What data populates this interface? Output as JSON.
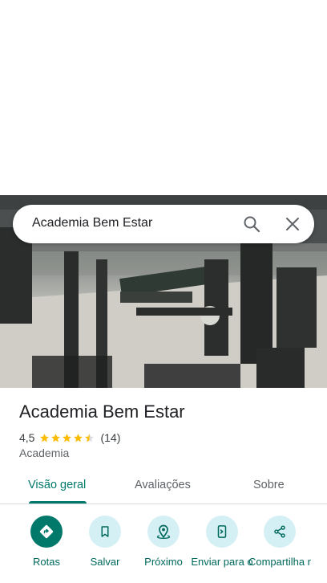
{
  "search": {
    "query": "Academia Bem Estar"
  },
  "place": {
    "title": "Academia Bem Estar",
    "rating": "4,5",
    "rating_stars": 4.5,
    "review_count": "(14)",
    "category": "Academia"
  },
  "tabs": [
    {
      "label": "Visão geral",
      "active": true
    },
    {
      "label": "Avaliações",
      "active": false
    },
    {
      "label": "Sobre",
      "active": false
    }
  ],
  "actions": [
    {
      "label": "Rotas",
      "icon": "directions-icon"
    },
    {
      "label": "Salvar",
      "icon": "bookmark-icon"
    },
    {
      "label": "Próximo",
      "icon": "nearby-icon"
    },
    {
      "label": "Enviar para o",
      "icon": "send-to-phone-icon"
    },
    {
      "label": "Compartilha r",
      "icon": "share-icon"
    }
  ],
  "colors": {
    "accent": "#00796b",
    "action_bg": "#d4f0f5",
    "star": "#fbbc04"
  }
}
